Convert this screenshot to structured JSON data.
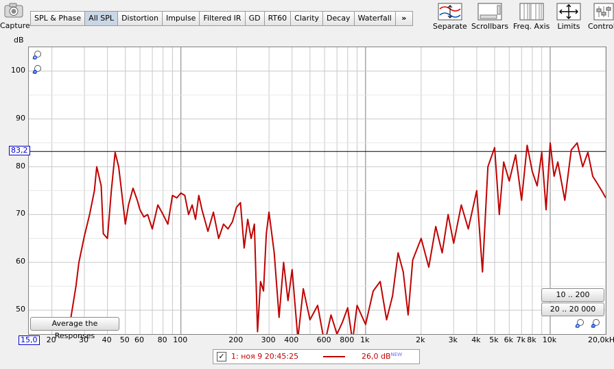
{
  "capture": {
    "label": "Capture"
  },
  "tabs": [
    "SPL & Phase",
    "All SPL",
    "Distortion",
    "Impulse",
    "Filtered IR",
    "GD",
    "RT60",
    "Clarity",
    "Decay",
    "Waterfall"
  ],
  "tabs_more": "»",
  "tools": {
    "separate": "Separate",
    "scrollbars": "Scrollbars",
    "freq_axis": "Freq. Axis",
    "limits": "Limits",
    "controls": "Controls"
  },
  "y_unit": "dB",
  "cursor": {
    "level_label": "83,2",
    "bottom_label": "15,0"
  },
  "buttons": {
    "average": "Average the Responses",
    "range_low": "10 .. 200",
    "range_full": "20 .. 20 000"
  },
  "legend": {
    "checked": "✓",
    "name": "1: ноя 9 20:45:25",
    "value": "26,0 dB",
    "badge": "NEW"
  },
  "chart_data": {
    "type": "line",
    "title": "",
    "xlabel": "",
    "ylabel": "dB",
    "x_scale": "log",
    "xlim": [
      15,
      20000
    ],
    "ylim": [
      45,
      105
    ],
    "grid": true,
    "cursor_level": 83.2,
    "y_ticks": [
      50,
      60,
      70,
      80,
      90,
      100
    ],
    "x_ticks": [
      {
        "v": 20,
        "label": "20"
      },
      {
        "v": 30,
        "label": "30"
      },
      {
        "v": 40,
        "label": "40"
      },
      {
        "v": 50,
        "label": "50"
      },
      {
        "v": 60,
        "label": "60"
      },
      {
        "v": 80,
        "label": "80"
      },
      {
        "v": 100,
        "label": "100"
      },
      {
        "v": 200,
        "label": "200"
      },
      {
        "v": 300,
        "label": "300"
      },
      {
        "v": 400,
        "label": "400"
      },
      {
        "v": 600,
        "label": "600"
      },
      {
        "v": 800,
        "label": "800"
      },
      {
        "v": 1000,
        "label": "1k"
      },
      {
        "v": 2000,
        "label": "2k"
      },
      {
        "v": 3000,
        "label": "3k"
      },
      {
        "v": 4000,
        "label": "4k"
      },
      {
        "v": 5000,
        "label": "5k"
      },
      {
        "v": 6000,
        "label": "6k"
      },
      {
        "v": 7000,
        "label": "7k"
      },
      {
        "v": 8000,
        "label": "8k"
      },
      {
        "v": 10000,
        "label": "10k"
      },
      {
        "v": 20000,
        "label": "20,0kHz"
      }
    ],
    "series": [
      {
        "color": "#c00000",
        "x": [
          25,
          27,
          28,
          30,
          32,
          34,
          35,
          37,
          38,
          40,
          42,
          44,
          46,
          48,
          50,
          52,
          55,
          58,
          60,
          63,
          66,
          70,
          75,
          80,
          85,
          90,
          95,
          100,
          105,
          110,
          115,
          120,
          125,
          130,
          140,
          150,
          160,
          170,
          180,
          190,
          200,
          210,
          220,
          230,
          240,
          250,
          260,
          270,
          280,
          290,
          300,
          320,
          340,
          360,
          380,
          400,
          430,
          460,
          500,
          550,
          600,
          650,
          700,
          750,
          800,
          850,
          900,
          1000,
          1100,
          1200,
          1300,
          1400,
          1500,
          1600,
          1700,
          1800,
          2000,
          2200,
          2400,
          2600,
          2800,
          3000,
          3300,
          3600,
          4000,
          4300,
          4600,
          5000,
          5300,
          5600,
          6000,
          6500,
          7000,
          7500,
          8000,
          8500,
          9000,
          9500,
          10000,
          10500,
          11000,
          12000,
          13000,
          14000,
          15000,
          16000,
          17000,
          18000,
          19000,
          20000
        ],
        "y": [
          47.0,
          55.0,
          60.0,
          65.5,
          70.0,
          75.0,
          80.0,
          76.0,
          66.0,
          65.0,
          75.0,
          83.0,
          80.0,
          74.0,
          68.0,
          72.0,
          75.5,
          73.0,
          71.0,
          69.5,
          70.0,
          67.0,
          72.0,
          70.0,
          68.0,
          74.0,
          73.5,
          74.5,
          74.0,
          70.0,
          72.0,
          69.0,
          74.0,
          71.0,
          66.5,
          70.5,
          65.0,
          68.0,
          67.0,
          68.5,
          71.5,
          72.5,
          63.0,
          69.0,
          65.0,
          68.0,
          45.5,
          56.0,
          54.0,
          66.0,
          70.5,
          62.0,
          48.5,
          60.0,
          52.0,
          58.5,
          44.0,
          54.5,
          48.0,
          51.0,
          43.0,
          49.0,
          45.0,
          47.5,
          50.5,
          43.5,
          51.0,
          47.0,
          54.0,
          56.0,
          48.0,
          53.0,
          62.0,
          58.0,
          49.0,
          60.5,
          65.0,
          59.0,
          67.5,
          62.0,
          70.0,
          64.0,
          72.0,
          67.0,
          75.0,
          58.0,
          80.0,
          84.0,
          70.0,
          81.0,
          77.0,
          82.5,
          73.0,
          84.5,
          79.0,
          76.0,
          83.0,
          71.0,
          85.0,
          78.0,
          81.0,
          73.0,
          83.5,
          85.0,
          80.0,
          83.0,
          78.0,
          76.5,
          75.0,
          73.5
        ]
      }
    ]
  }
}
